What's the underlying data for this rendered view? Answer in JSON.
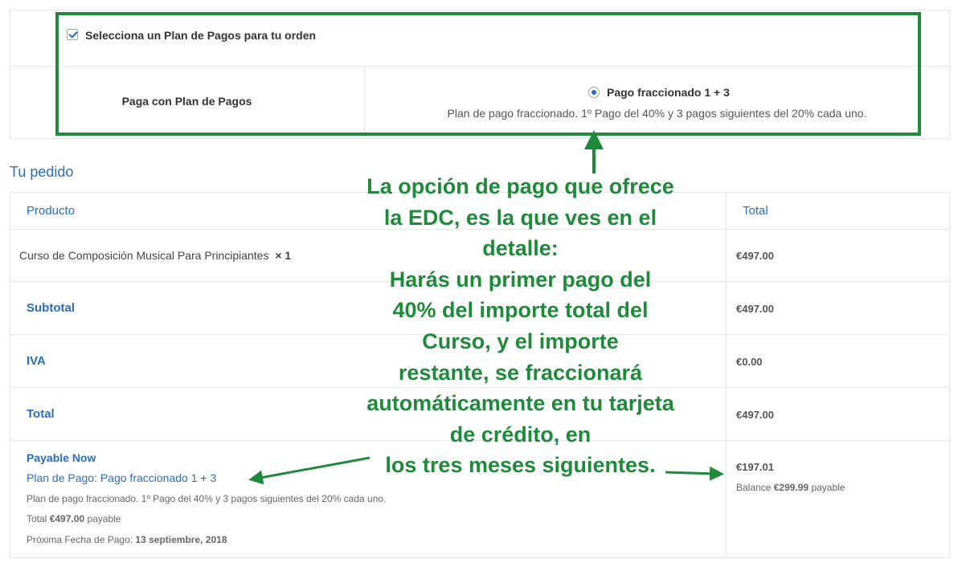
{
  "plan_selector": {
    "checkbox_label": "Selecciona un Plan de Pagos para tu orden",
    "row_label": "Paga con Plan de Pagos",
    "option_label": "Pago fraccionado 1 + 3",
    "option_description": "Plan de pago fraccionado. 1º Pago del 40% y 3 pagos siguientes del 20% cada uno.",
    "checkbox_checked": true,
    "option_selected": true
  },
  "order": {
    "heading": "Tu pedido",
    "columns": [
      "Producto",
      "Total"
    ],
    "product": {
      "name": "Curso de Composición Musical Para Principiantes",
      "qty": "× 1",
      "total": "€497.00"
    },
    "subtotal": {
      "label": "Subtotal",
      "value": "€497.00"
    },
    "tax": {
      "label": "IVA",
      "value": "€0.00"
    },
    "total": {
      "label": "Total",
      "value": "€497.00"
    },
    "payable_now": {
      "label": "Payable Now",
      "plan_link": "Plan de Pago: Pago fraccionado 1 + 3",
      "plan_desc": "Plan de pago fraccionado. 1º Pago del 40% y 3 pagos siguientes del 20% cada uno.",
      "total_prefix": "Total",
      "total_amount": "€497.00",
      "total_suffix": "payable",
      "next_date_prefix": "Próxima Fecha de Pago:",
      "next_date": "13 septiembre, 2018",
      "amount_now": "€197.01",
      "balance_prefix": "Balance",
      "balance_amount": "€299.99",
      "balance_suffix": "payable"
    }
  },
  "annotation": {
    "lines": [
      "La opción de pago que ofrece",
      "la EDC, es la que ves en el",
      "detalle:",
      "Harás un primer pago del",
      "40% del importe total del",
      "Curso, y el importe",
      "restante, se fraccionará",
      "automáticamente en tu tarjeta",
      "de crédito, en",
      "los tres meses siguientes."
    ],
    "color": "#1f8a3b"
  },
  "colors": {
    "accent": "#2a6ebb",
    "annotation_green": "#1f8a3b",
    "border": "#e6e6e6"
  }
}
